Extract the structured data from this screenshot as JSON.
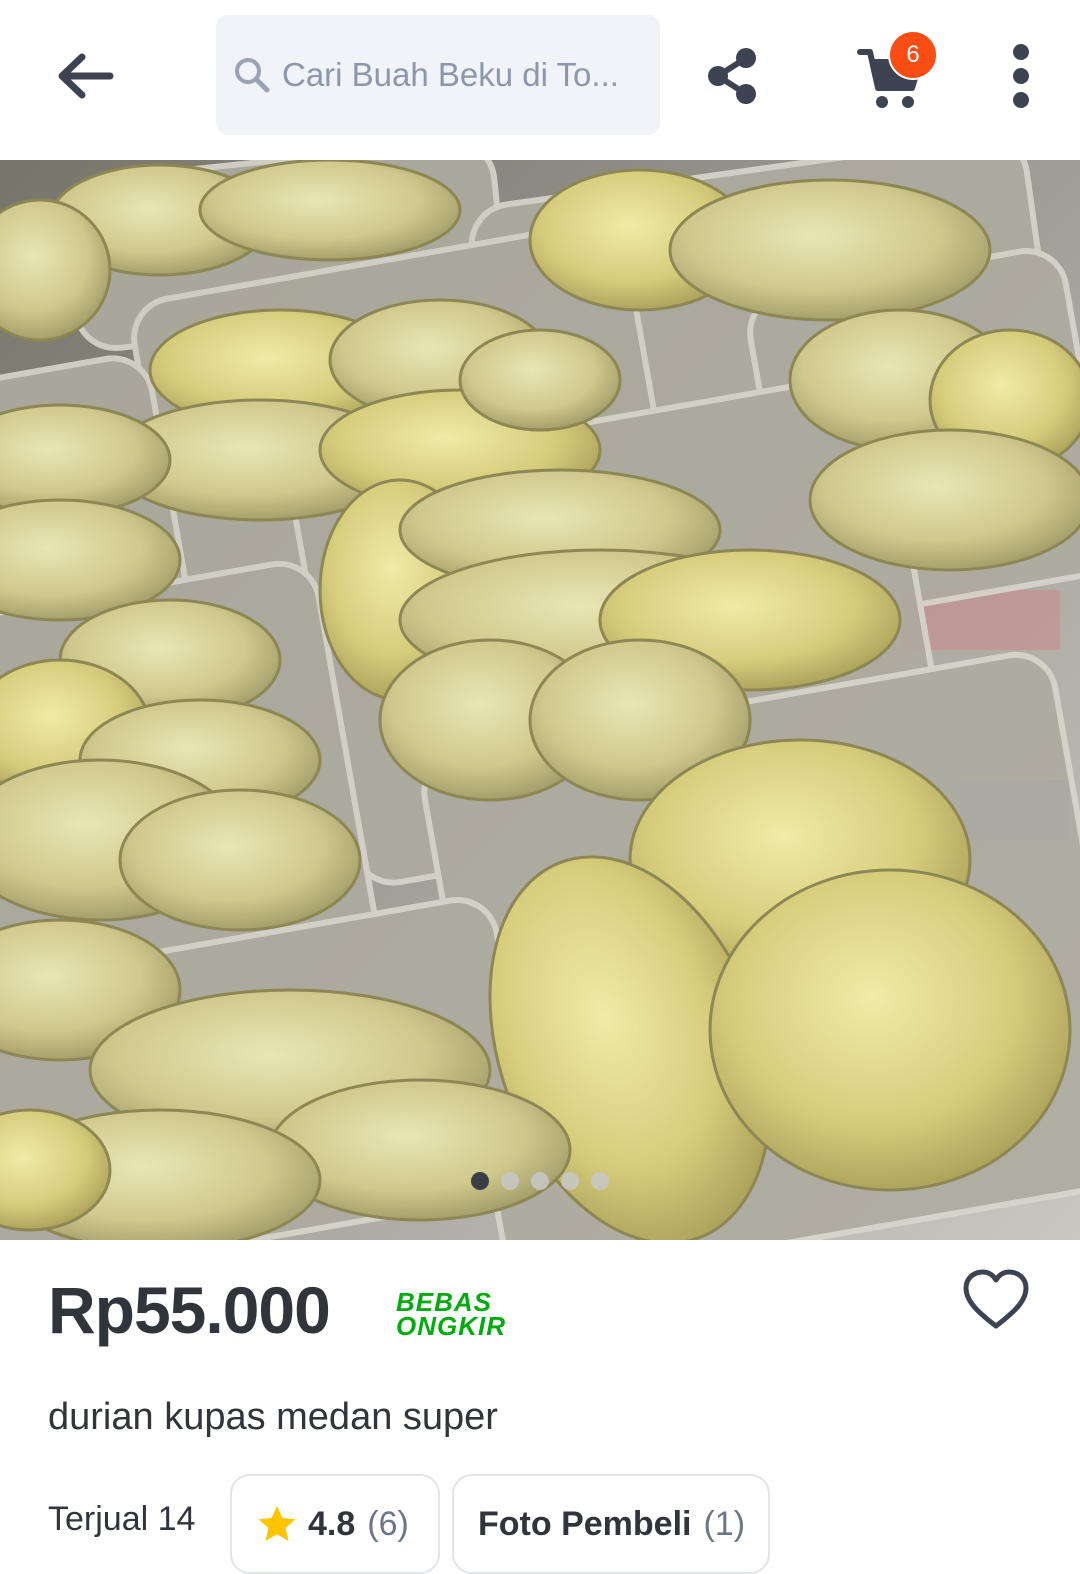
{
  "header": {
    "search_placeholder": "Cari Buah Beku di To...",
    "cart_count": "6",
    "icons": [
      "back-arrow-icon",
      "search-icon",
      "share-icon",
      "cart-icon",
      "more-vertical-icon"
    ]
  },
  "gallery": {
    "total_images": 5,
    "active_index": 0
  },
  "product": {
    "price": "Rp55.000",
    "free_shipping_line1": "BEBAS",
    "free_shipping_line2": "ONGKIR",
    "name": "durian kupas medan super",
    "sold": "Terjual 14",
    "rating": "4.8",
    "rating_count": "(6)",
    "buyer_photos_label": "Foto Pembeli",
    "buyer_photos_count": "(1)"
  },
  "colors": {
    "accent_green": "#03ac0e",
    "badge_orange": "#f94d14",
    "star_yellow": "#ffc400",
    "text_dark": "#31353b"
  }
}
